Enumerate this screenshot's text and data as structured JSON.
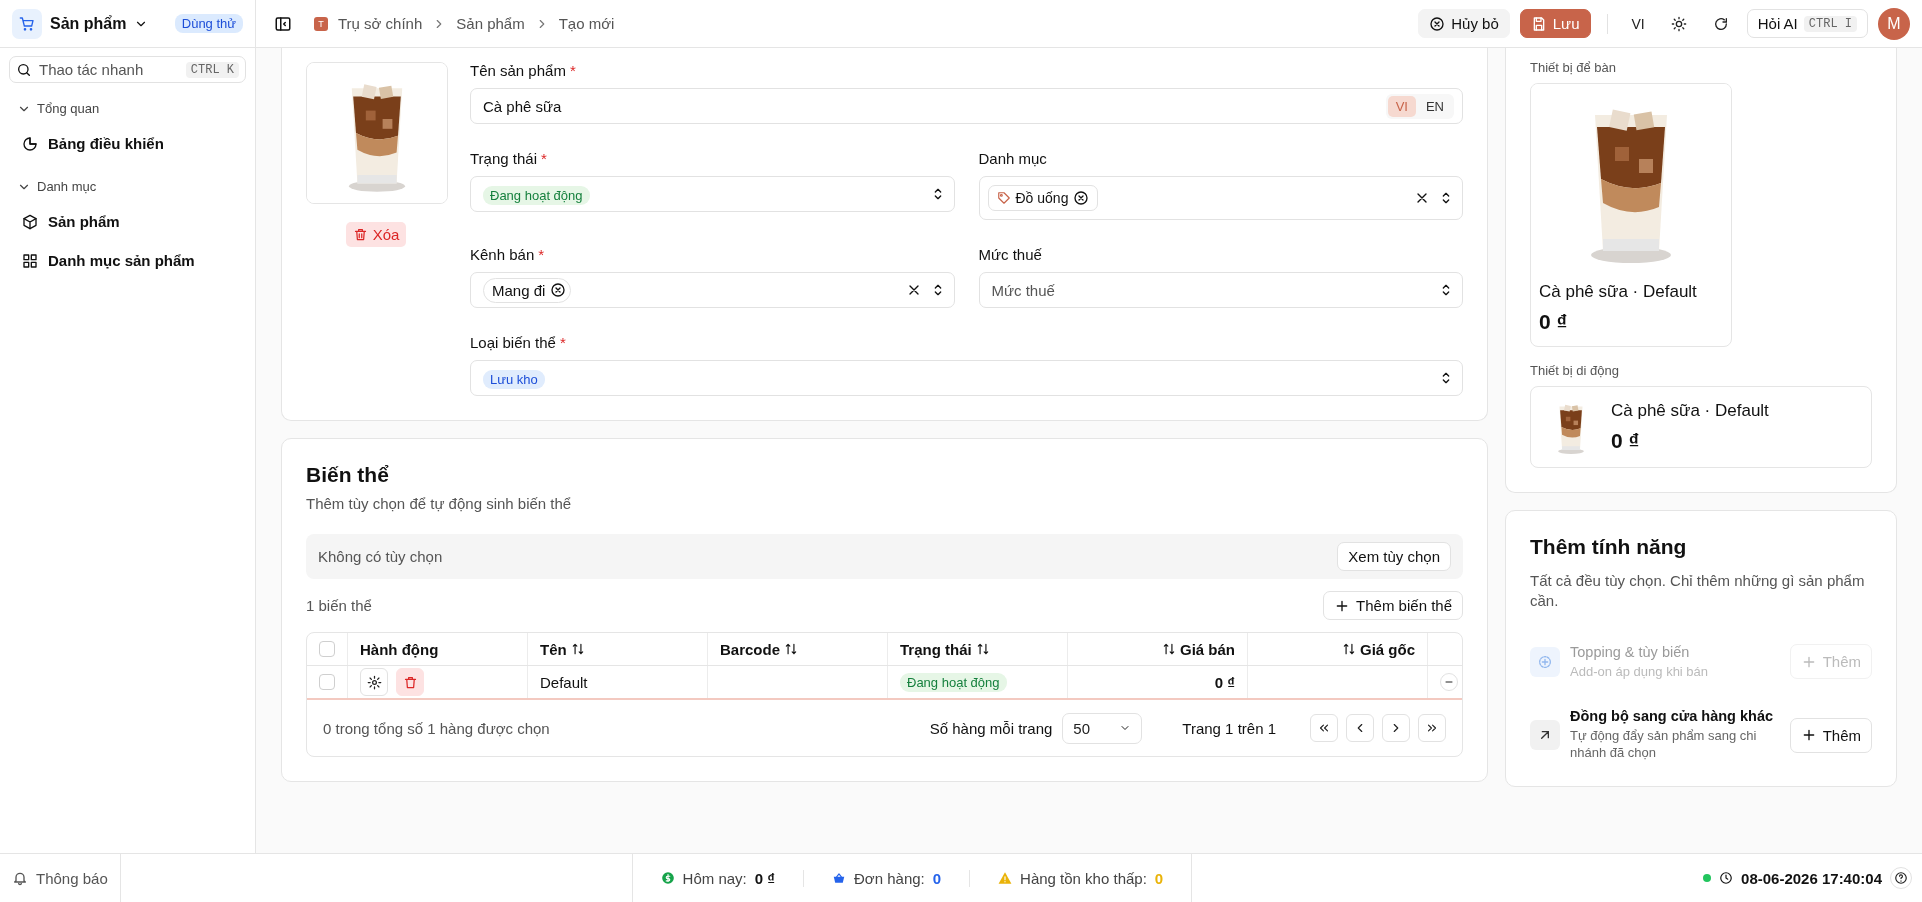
{
  "app": {
    "name": "Sản phẩm",
    "badge": "Dùng thử"
  },
  "topbar": {
    "org_initial": "T",
    "breadcrumbs": [
      "Trụ sở chính",
      "Sản phẩm",
      "Tạo mới"
    ],
    "cancel": "Hủy bỏ",
    "save": "Lưu",
    "language": "VI",
    "ask_ai": "Hỏi AI",
    "ask_ai_shortcut": "CTRL I",
    "avatar": "M"
  },
  "sidebar": {
    "search": {
      "placeholder": "Thao tác nhanh",
      "shortcut": "CTRL K"
    },
    "groups": [
      {
        "label": "Tổng quan",
        "expanded": true,
        "items": [
          {
            "label": "Bảng điều khiển"
          }
        ]
      },
      {
        "label": "Danh mục",
        "expanded": true,
        "items": [
          {
            "label": "Sản phẩm"
          },
          {
            "label": "Danh mục sản phẩm"
          }
        ]
      }
    ]
  },
  "product_form": {
    "delete_image": "Xóa",
    "name": {
      "label": "Tên sản phẩm",
      "required_mark": "*",
      "value": "Cà phê sữa",
      "languages": [
        {
          "label": "VI",
          "selected": true
        },
        {
          "label": "EN",
          "selected": false
        }
      ]
    },
    "status": {
      "label": "Trạng thái",
      "required_mark": "*",
      "value": "Đang hoạt động"
    },
    "category": {
      "label": "Danh mục",
      "tags": [
        "Đồ uống"
      ]
    },
    "channel": {
      "label": "Kênh bán",
      "required_mark": "*",
      "tags": [
        "Mang đi"
      ]
    },
    "tax": {
      "label": "Mức thuế",
      "placeholder": "Mức thuế"
    },
    "variant_type": {
      "label": "Loại biến thể",
      "required_mark": "*",
      "value": "Lưu kho"
    }
  },
  "variants": {
    "title": "Biến thể",
    "subtitle": "Thêm tùy chọn để tự động sinh biến thể",
    "options_empty": "Không có tùy chọn",
    "view_options": "Xem tùy chọn",
    "count": "1 biến thể",
    "add_variant": "Thêm biến thể",
    "table": {
      "all_selected": false,
      "columns": [
        {
          "label": "Hành động",
          "sortable": false
        },
        {
          "label": "Tên",
          "sortable": true
        },
        {
          "label": "Barcode",
          "sortable": true
        },
        {
          "label": "Trạng thái",
          "sortable": true
        },
        {
          "label": "Giá bán",
          "sortable": true
        },
        {
          "label": "Giá gốc",
          "sortable": true
        }
      ],
      "rows": [
        {
          "selected": false,
          "name": "Default",
          "status": "Đang hoạt động",
          "price": "0 ₫"
        }
      ],
      "selection_summary": "0 trong tổng số 1 hàng được chọn",
      "rows_per_page_label": "Số hàng mỗi trang",
      "rows_per_page": "50",
      "page_info": "Trang 1 trên 1"
    }
  },
  "preview": {
    "desktop_label": "Thiết bị để bàn",
    "desktop": {
      "title": "Cà phê sữa · Default",
      "price": "0 ₫"
    },
    "mobile_label": "Thiết bị di động",
    "mobile": {
      "title": "Cà phê sữa · Default",
      "price": "0 ₫"
    }
  },
  "features": {
    "title": "Thêm tính năng",
    "description": "Tất cả đều tùy chọn. Chỉ thêm những gì sản phẩm cần.",
    "items": [
      {
        "title": "Topping & tùy biến",
        "subtitle": "Add-on áp dụng khi bán",
        "button": "Thêm",
        "disabled": true
      },
      {
        "title": "Đồng bộ sang cửa hàng khác",
        "subtitle": "Tự động đẩy sản phẩm sang chi nhánh đã chọn",
        "button": "Thêm",
        "disabled": false
      }
    ]
  },
  "status_bar": {
    "notifications": "Thông báo",
    "stats": [
      {
        "label": "Hôm nay:",
        "value": "0 ₫",
        "color": "#16a34a"
      },
      {
        "label": "Đơn hàng:",
        "value": "0",
        "color": "#2563eb"
      },
      {
        "label": "Hàng tồn kho thấp:",
        "value": "0",
        "color": "#eab308"
      }
    ],
    "online": true,
    "datetime": "08-06-2026 17:40:04"
  }
}
